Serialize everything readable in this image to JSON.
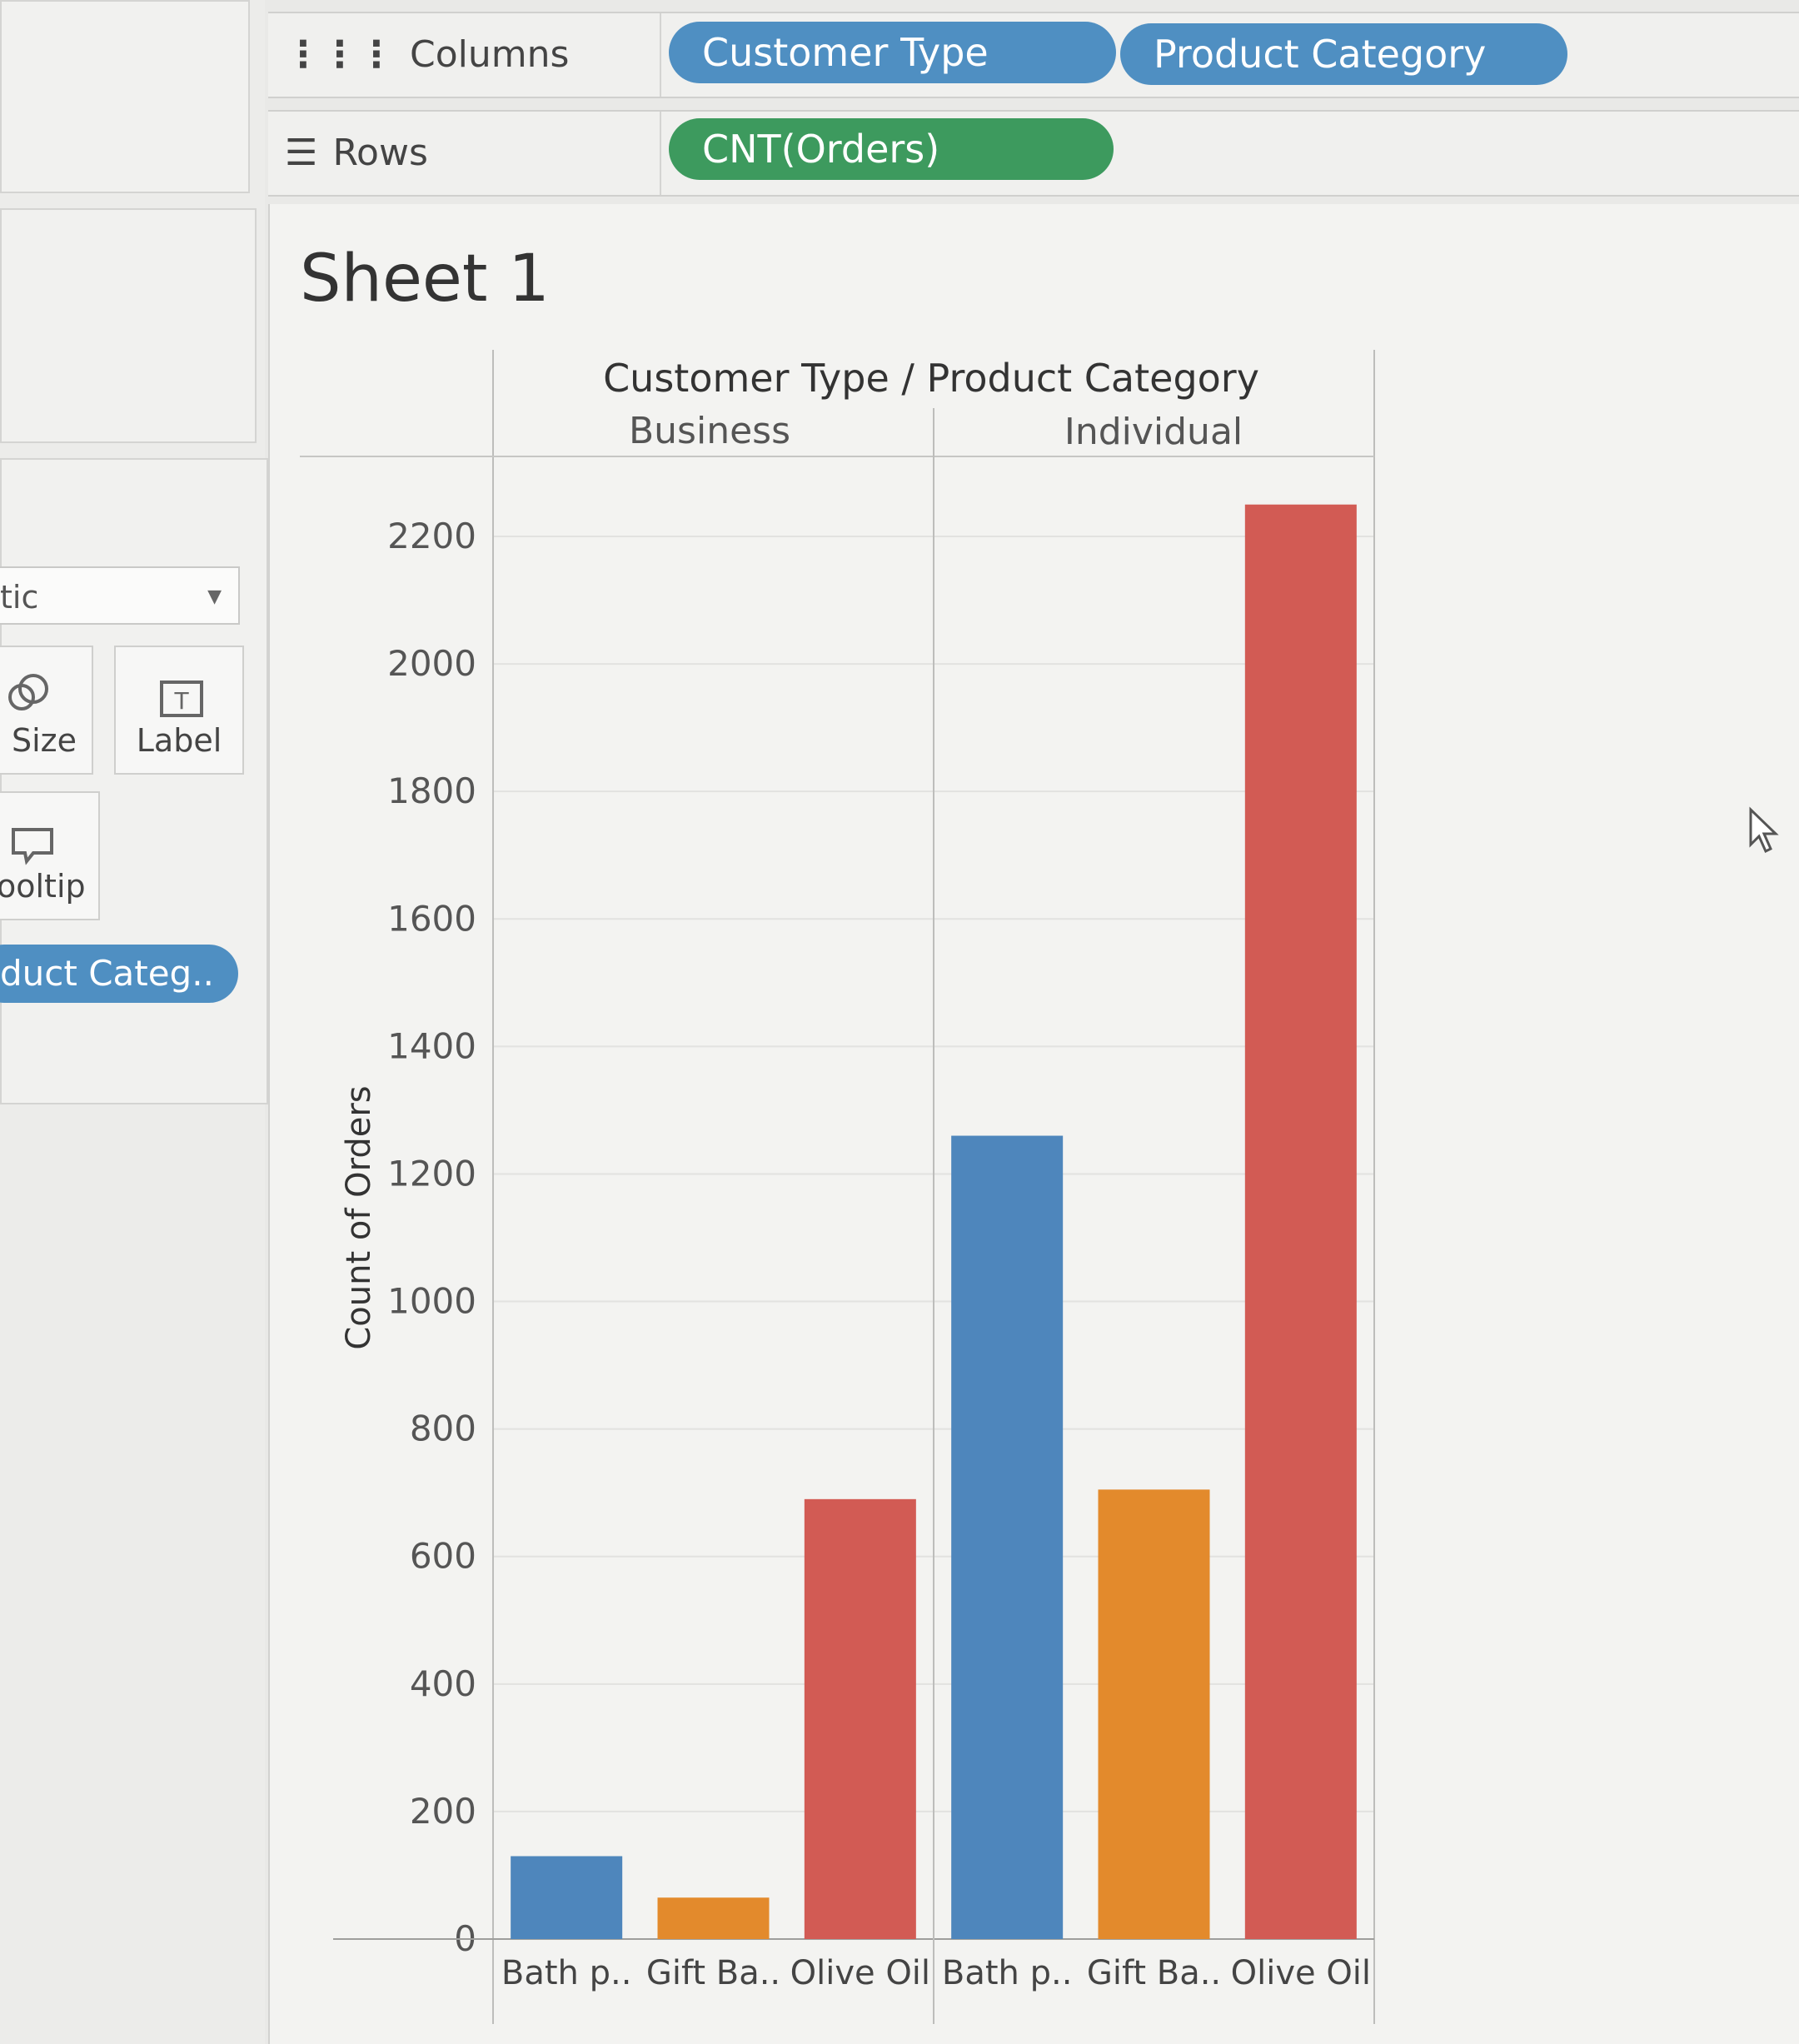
{
  "shelves": {
    "columns_label": "Columns",
    "rows_label": "Rows",
    "columns_pills": [
      "Customer Type",
      "Product Category"
    ],
    "rows_pills": [
      "CNT(Orders)"
    ]
  },
  "marks": {
    "mark_type": "tic",
    "size_label": "Size",
    "label_label": "Label",
    "tooltip_label": "ooltip",
    "color_pill": "duct Categ.."
  },
  "sheet": {
    "title": "Sheet 1"
  },
  "colors": {
    "Bath p..": "#4e86bc",
    "Gift Ba..": "#e38a2c",
    "Olive Oil": "#d25b54",
    "pill_blue": "#4f8fc2",
    "pill_green": "#3d9a5e"
  },
  "chart_data": {
    "type": "bar",
    "header_title": "Customer Type / Product Category",
    "ylabel": "Count of Orders",
    "ylim": [
      0,
      2300
    ],
    "yticks": [
      0,
      200,
      400,
      600,
      800,
      1000,
      1200,
      1400,
      1600,
      1800,
      2000,
      2200
    ],
    "grid": true,
    "groups": [
      {
        "name": "Business",
        "categories": [
          "Bath p..",
          "Gift Ba..",
          "Olive Oil"
        ],
        "values": [
          130,
          65,
          690
        ]
      },
      {
        "name": "Individual",
        "categories": [
          "Bath p..",
          "Gift Ba..",
          "Olive Oil"
        ],
        "values": [
          1260,
          705,
          2250
        ]
      }
    ]
  }
}
